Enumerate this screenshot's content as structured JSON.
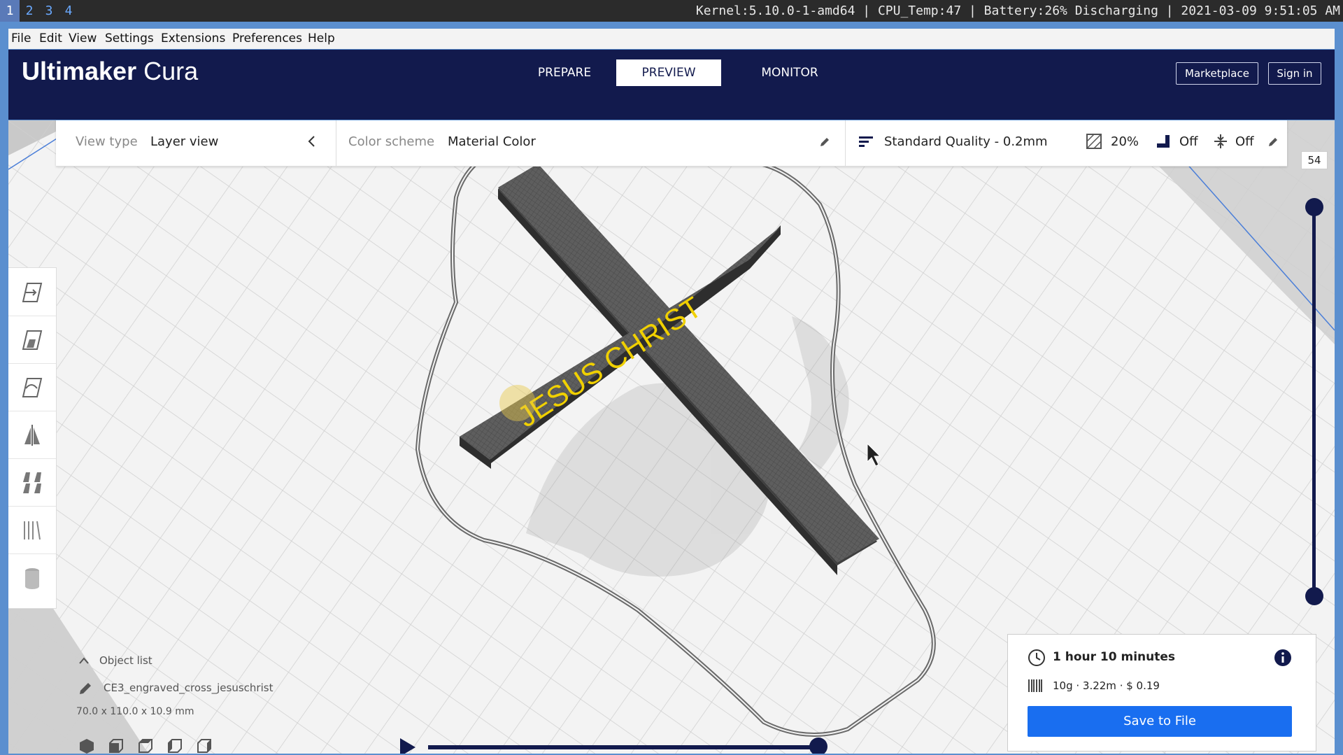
{
  "system_bar": {
    "workspaces": [
      "1",
      "2",
      "3",
      "4"
    ],
    "active_workspace": "1",
    "info": "Kernel:5.10.0-1-amd64 | CPU_Temp:47 | Battery:26% Discharging | 2021-03-09 9:51:05 AM"
  },
  "menu": {
    "file": "File",
    "edit": "Edit",
    "view": "View",
    "settings": "Settings",
    "extensions": "Extensions",
    "preferences": "Preferences",
    "help": "Help"
  },
  "header": {
    "logo_bold": "Ultimaker",
    "logo_light": "Cura",
    "stages": [
      "PREPARE",
      "PREVIEW",
      "MONITOR"
    ],
    "active_stage": "PREVIEW",
    "marketplace": "Marketplace",
    "sign_in": "Sign in"
  },
  "view_settings": {
    "view_type_label": "View type",
    "view_type_value": "Layer view",
    "color_scheme_label": "Color scheme",
    "color_scheme_value": "Material Color",
    "quality": "Standard Quality - 0.2mm",
    "infill": "20%",
    "support": "Off",
    "adhesion": "Off"
  },
  "scene": {
    "model_text": "JESUS CHRIST",
    "model_text_color": "#f0d000",
    "model_color": "#5a5a5a"
  },
  "layer_slider": {
    "current_layer": "54"
  },
  "object_list": {
    "title": "Object list",
    "object_name": "CE3_engraved_cross_jesuschrist",
    "dimensions": "70.0 x 110.0 x 10.9 mm"
  },
  "print_info": {
    "time": "1 hour 10 minutes",
    "material": "10g · 3.22m · $ 0.19",
    "save_button": "Save to File"
  },
  "colors": {
    "accent_blue": "#196ef0",
    "header_navy": "#121a4d",
    "window_frame": "#5b8fcf"
  }
}
